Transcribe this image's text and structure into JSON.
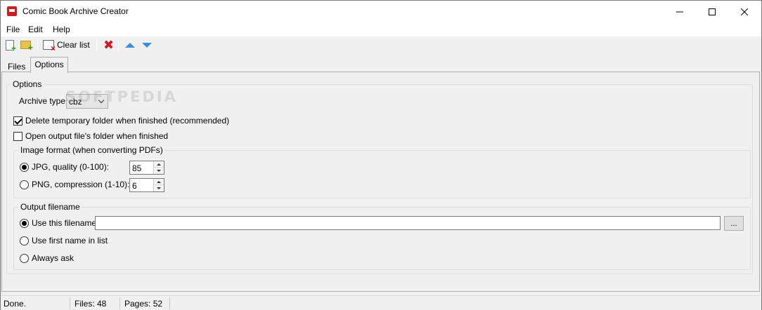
{
  "window": {
    "title": "Comic Book Archive Creator"
  },
  "menu": [
    "File",
    "Edit",
    "Help"
  ],
  "toolbar": {
    "clear_list_label": "Clear list"
  },
  "tabs": [
    "Files",
    "Options"
  ],
  "options": {
    "group_title": "Options",
    "archive_type_label": "Archive type:",
    "archive_type_value": "cbz",
    "delete_temp_label": "Delete temporary folder when finished (recommended)",
    "delete_temp_checked": true,
    "open_output_label": "Open output file's folder when finished",
    "open_output_checked": false
  },
  "image_format": {
    "group_title": "Image format (when converting PDFs)",
    "jpg_label": "JPG, quality (0-100):",
    "jpg_value": "85",
    "png_label": "PNG, compression (1-10):",
    "png_value": "6",
    "selected": "jpg"
  },
  "output_filename": {
    "group_title": "Output filename",
    "use_this_label": "Use this filename:",
    "filename_value": "",
    "browse_label": "...",
    "use_first_label": "Use first name in list",
    "always_ask_label": "Always ask",
    "selected": "use_this"
  },
  "watermark": "SOFTPEDIA",
  "status": {
    "state": "Done.",
    "files": "Files: 48",
    "pages": "Pages: 52"
  }
}
